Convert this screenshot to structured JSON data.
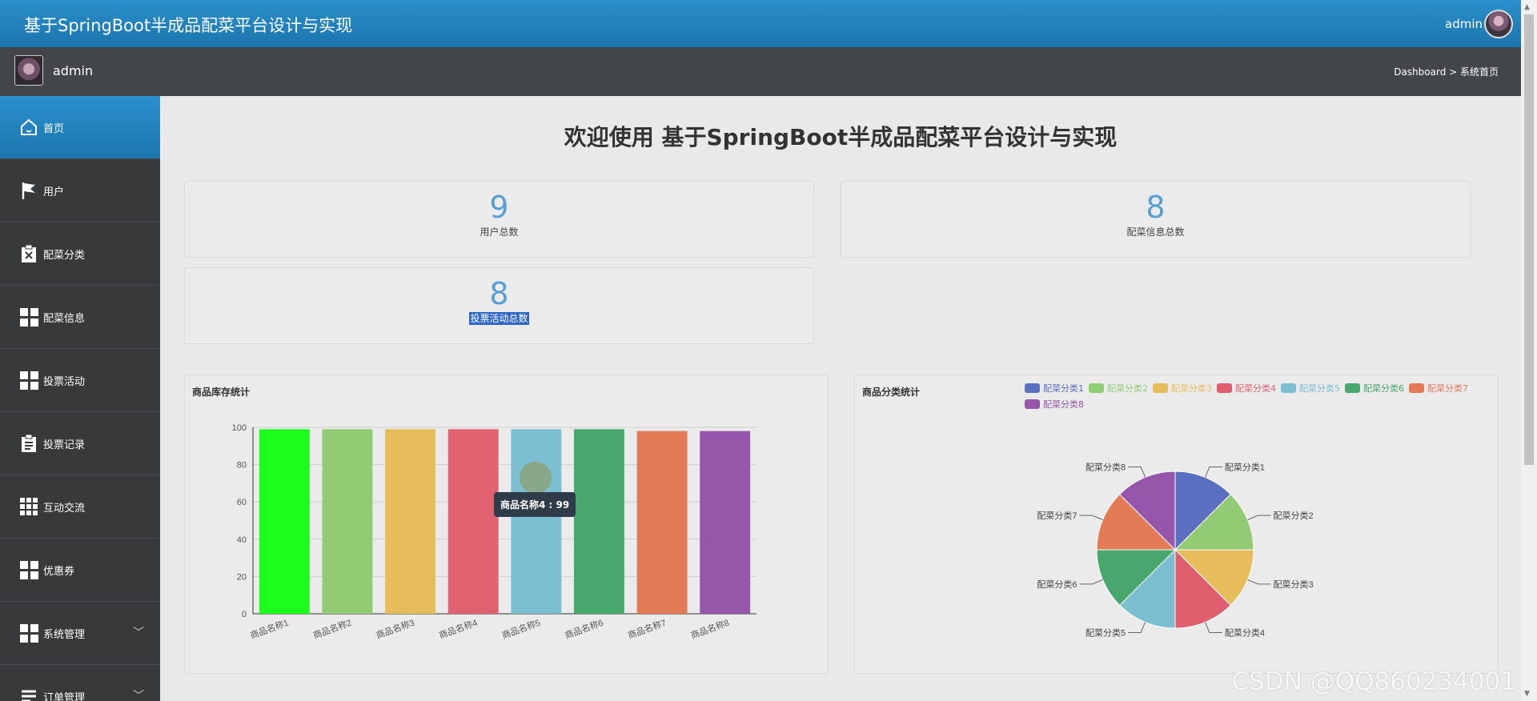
{
  "header": {
    "title": "基于SpringBoot半成品配菜平台设计与实现",
    "user": "admin"
  },
  "subheader": {
    "name": "admin",
    "breadcrumb": "Dashboard > 系统首页"
  },
  "sidebar": {
    "items": [
      {
        "label": "首页",
        "icon": "home-icon"
      },
      {
        "label": "用户",
        "icon": "flag-icon"
      },
      {
        "label": "配菜分类",
        "icon": "clipboard-x-icon"
      },
      {
        "label": "配菜信息",
        "icon": "grid-icon"
      },
      {
        "label": "投票活动",
        "icon": "grid-icon"
      },
      {
        "label": "投票记录",
        "icon": "clipboard-list-icon"
      },
      {
        "label": "互动交流",
        "icon": "grid9-icon"
      },
      {
        "label": "优惠券",
        "icon": "grid-icon"
      },
      {
        "label": "系统管理",
        "icon": "grid-icon",
        "expand": "﹀"
      },
      {
        "label": "订单管理",
        "icon": "list-icon",
        "expand": "﹀"
      }
    ]
  },
  "welcome": "欢迎使用 基于SpringBoot半成品配菜平台设计与实现",
  "stats": [
    {
      "value": "9",
      "label": "用户总数"
    },
    {
      "value": "8",
      "label": "配菜信息总数"
    },
    {
      "value": "8",
      "label": "投票活动总数"
    }
  ],
  "watermark": "CSDN @QQ860234001",
  "chart_data": [
    {
      "type": "bar",
      "title": "商品库存统计",
      "categories": [
        "商品名称1",
        "商品名称2",
        "商品名称3",
        "商品名称4",
        "商品名称5",
        "商品名称6",
        "商品名称7",
        "商品名称8"
      ],
      "values": [
        99,
        99,
        99,
        99,
        99,
        99,
        98,
        98
      ],
      "ylim": [
        0,
        100
      ],
      "yticks": [
        0,
        20,
        40,
        60,
        80,
        100
      ],
      "colors": [
        "#1cff1c",
        "#91cc75",
        "#e6bd5a",
        "#e06170",
        "#7bbfd1",
        "#47a76d",
        "#e47b57",
        "#9657ab"
      ],
      "tooltip": "商品名称4 : 99"
    },
    {
      "type": "pie",
      "title": "商品分类统计",
      "labels": [
        "配菜分类1",
        "配菜分类2",
        "配菜分类3",
        "配菜分类4",
        "配菜分类5",
        "配菜分类6",
        "配菜分类7",
        "配菜分类8"
      ],
      "values": [
        1,
        1,
        1,
        1,
        1,
        1,
        1,
        1
      ],
      "colors": [
        "#5b6fc0",
        "#91cc75",
        "#e6bd5a",
        "#df5f6f",
        "#7bbfd1",
        "#47a76d",
        "#e47b57",
        "#9657ab"
      ],
      "legend": "top"
    }
  ]
}
